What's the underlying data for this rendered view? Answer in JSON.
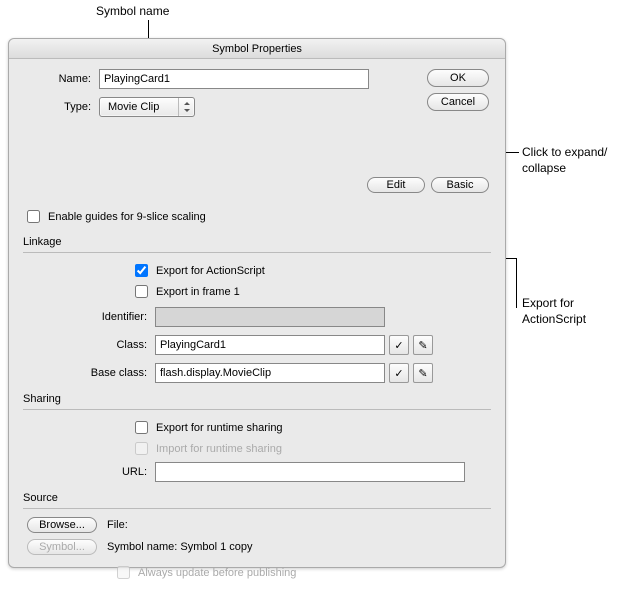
{
  "callouts": {
    "symbol_name": "Symbol name",
    "expand_collapse": "Click to expand/\ncollapse",
    "export_action": "Export for\nActionScript"
  },
  "dialog": {
    "title": "Symbol Properties",
    "name_label": "Name:",
    "name_value": "PlayingCard1",
    "type_label": "Type:",
    "type_value": "Movie Clip",
    "ok": "OK",
    "cancel": "Cancel",
    "edit": "Edit",
    "basic": "Basic",
    "enable_9slice": "Enable guides for 9-slice scaling",
    "linkage": {
      "title": "Linkage",
      "export_actionscript": "Export for ActionScript",
      "export_frame1": "Export in frame 1",
      "identifier_label": "Identifier:",
      "identifier_value": "",
      "class_label": "Class:",
      "class_value": "PlayingCard1",
      "baseclass_label": "Base class:",
      "baseclass_value": "flash.display.MovieClip",
      "check_glyph": "✓",
      "pencil_glyph": "✎"
    },
    "sharing": {
      "title": "Sharing",
      "export_runtime": "Export for runtime sharing",
      "import_runtime": "Import for runtime sharing",
      "url_label": "URL:",
      "url_value": ""
    },
    "source": {
      "title": "Source",
      "browse": "Browse...",
      "file_label": "File:",
      "symbol_btn": "Symbol...",
      "symbol_name_label": "Symbol name: Symbol 1 copy",
      "always_update": "Always update before publishing"
    }
  }
}
